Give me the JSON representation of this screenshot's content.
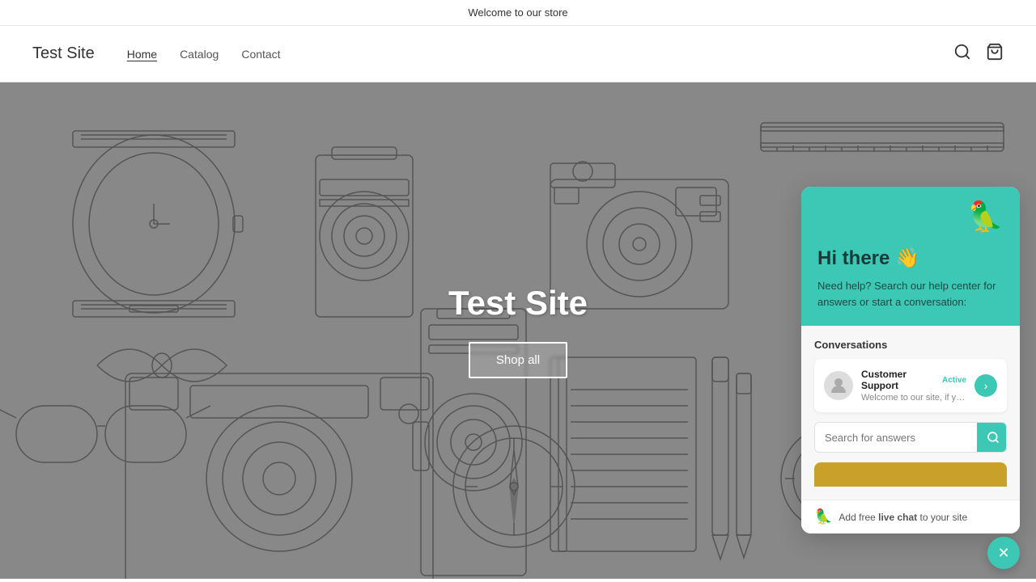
{
  "announcement": {
    "text": "Welcome to our store"
  },
  "header": {
    "logo": "Test Site",
    "nav": [
      {
        "label": "Home",
        "active": true
      },
      {
        "label": "Catalog",
        "active": false
      },
      {
        "label": "Contact",
        "active": false
      }
    ],
    "icons": {
      "search": "🔍",
      "cart": "🛒"
    }
  },
  "hero": {
    "title": "Test Site",
    "cta": "Shop all"
  },
  "chat": {
    "greeting": "Hi there 👋",
    "subtitle": "Need help? Search our help center for answers or start a conversation:",
    "conversations_label": "Conversations",
    "conversation": {
      "name": "Customer Support",
      "status": "Active",
      "preview": "Welcome to our site, if you ne...",
      "avatar": "👤"
    },
    "search_placeholder": "Search for answers",
    "footer": {
      "icon": "🦜",
      "text": "Add free live chat to your site"
    },
    "parrot": "🦜",
    "wave": "👋"
  },
  "colors": {
    "teal": "#3cc8b4",
    "dark_teal": "#1a4a44"
  }
}
